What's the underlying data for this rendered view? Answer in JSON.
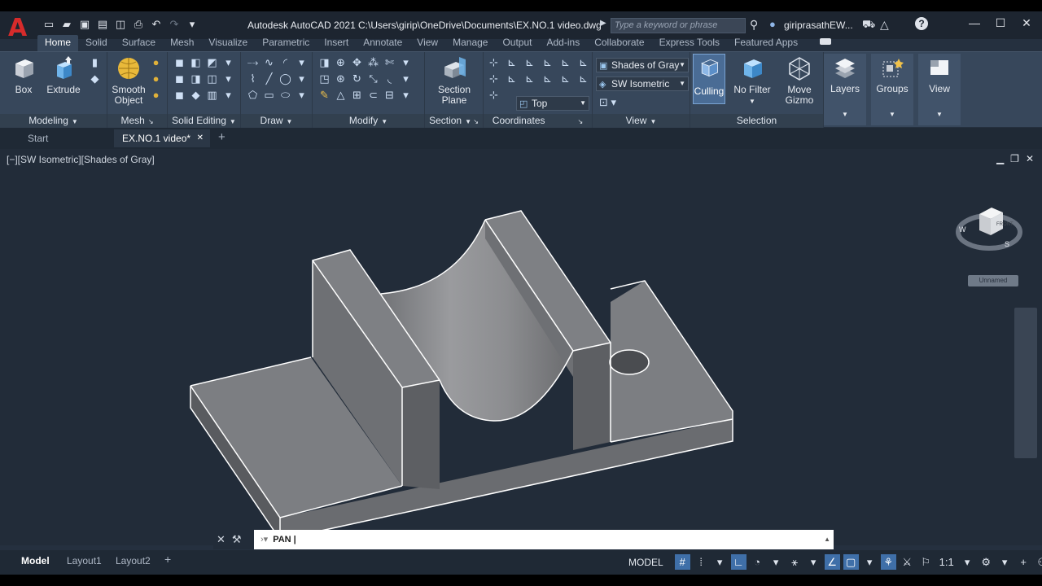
{
  "app": {
    "title": "Autodesk AutoCAD 2021",
    "file_path": "C:\\Users\\girip\\OneDrive\\Documents\\EX.NO.1 video.dwg",
    "search_placeholder": "Type a keyword or phrase",
    "user_name": "giriprasathEW...",
    "logo_letter": "A"
  },
  "ribbon_tabs": [
    "Home",
    "Solid",
    "Surface",
    "Mesh",
    "Visualize",
    "Parametric",
    "Insert",
    "Annotate",
    "View",
    "Manage",
    "Output",
    "Add-ins",
    "Collaborate",
    "Express Tools",
    "Featured Apps"
  ],
  "panels": {
    "modeling": "Modeling",
    "mesh": "Mesh",
    "solid_editing": "Solid Editing",
    "draw": "Draw",
    "modify": "Modify",
    "section": "Section",
    "coordinates": "Coordinates",
    "view": "View",
    "selection": "Selection"
  },
  "tools": {
    "box": "Box",
    "extrude": "Extrude",
    "smooth_object_1": "Smooth",
    "smooth_object_2": "Object",
    "section_plane_1": "Section",
    "section_plane_2": "Plane",
    "culling": "Culling",
    "no_filter": "No Filter",
    "move_gizmo_1": "Move",
    "move_gizmo_2": "Gizmo",
    "layers": "Layers",
    "groups": "Groups",
    "view": "View"
  },
  "dropdowns": {
    "visual_style": "Shades of Gray",
    "view_direction": "SW Isometric",
    "ucs": "Top"
  },
  "doc_tabs": {
    "start": "Start",
    "active_file": "EX.NO.1 video*"
  },
  "viewport": {
    "label": "[−][SW Isometric][Shades of Gray]",
    "viewcube_face": "FRONT",
    "compass": {
      "w": "W",
      "s": "S"
    },
    "ucs_button": "Unnamed"
  },
  "command": {
    "text": "PAN"
  },
  "layout_tabs": [
    "Model",
    "Layout1",
    "Layout2"
  ],
  "status": {
    "space": "MODEL",
    "scale": "1:1"
  },
  "colors": {
    "background": "#222c39",
    "ribbon": "#37475b",
    "accent": "#3f6fa8",
    "logo_red": "#d62b2b"
  }
}
